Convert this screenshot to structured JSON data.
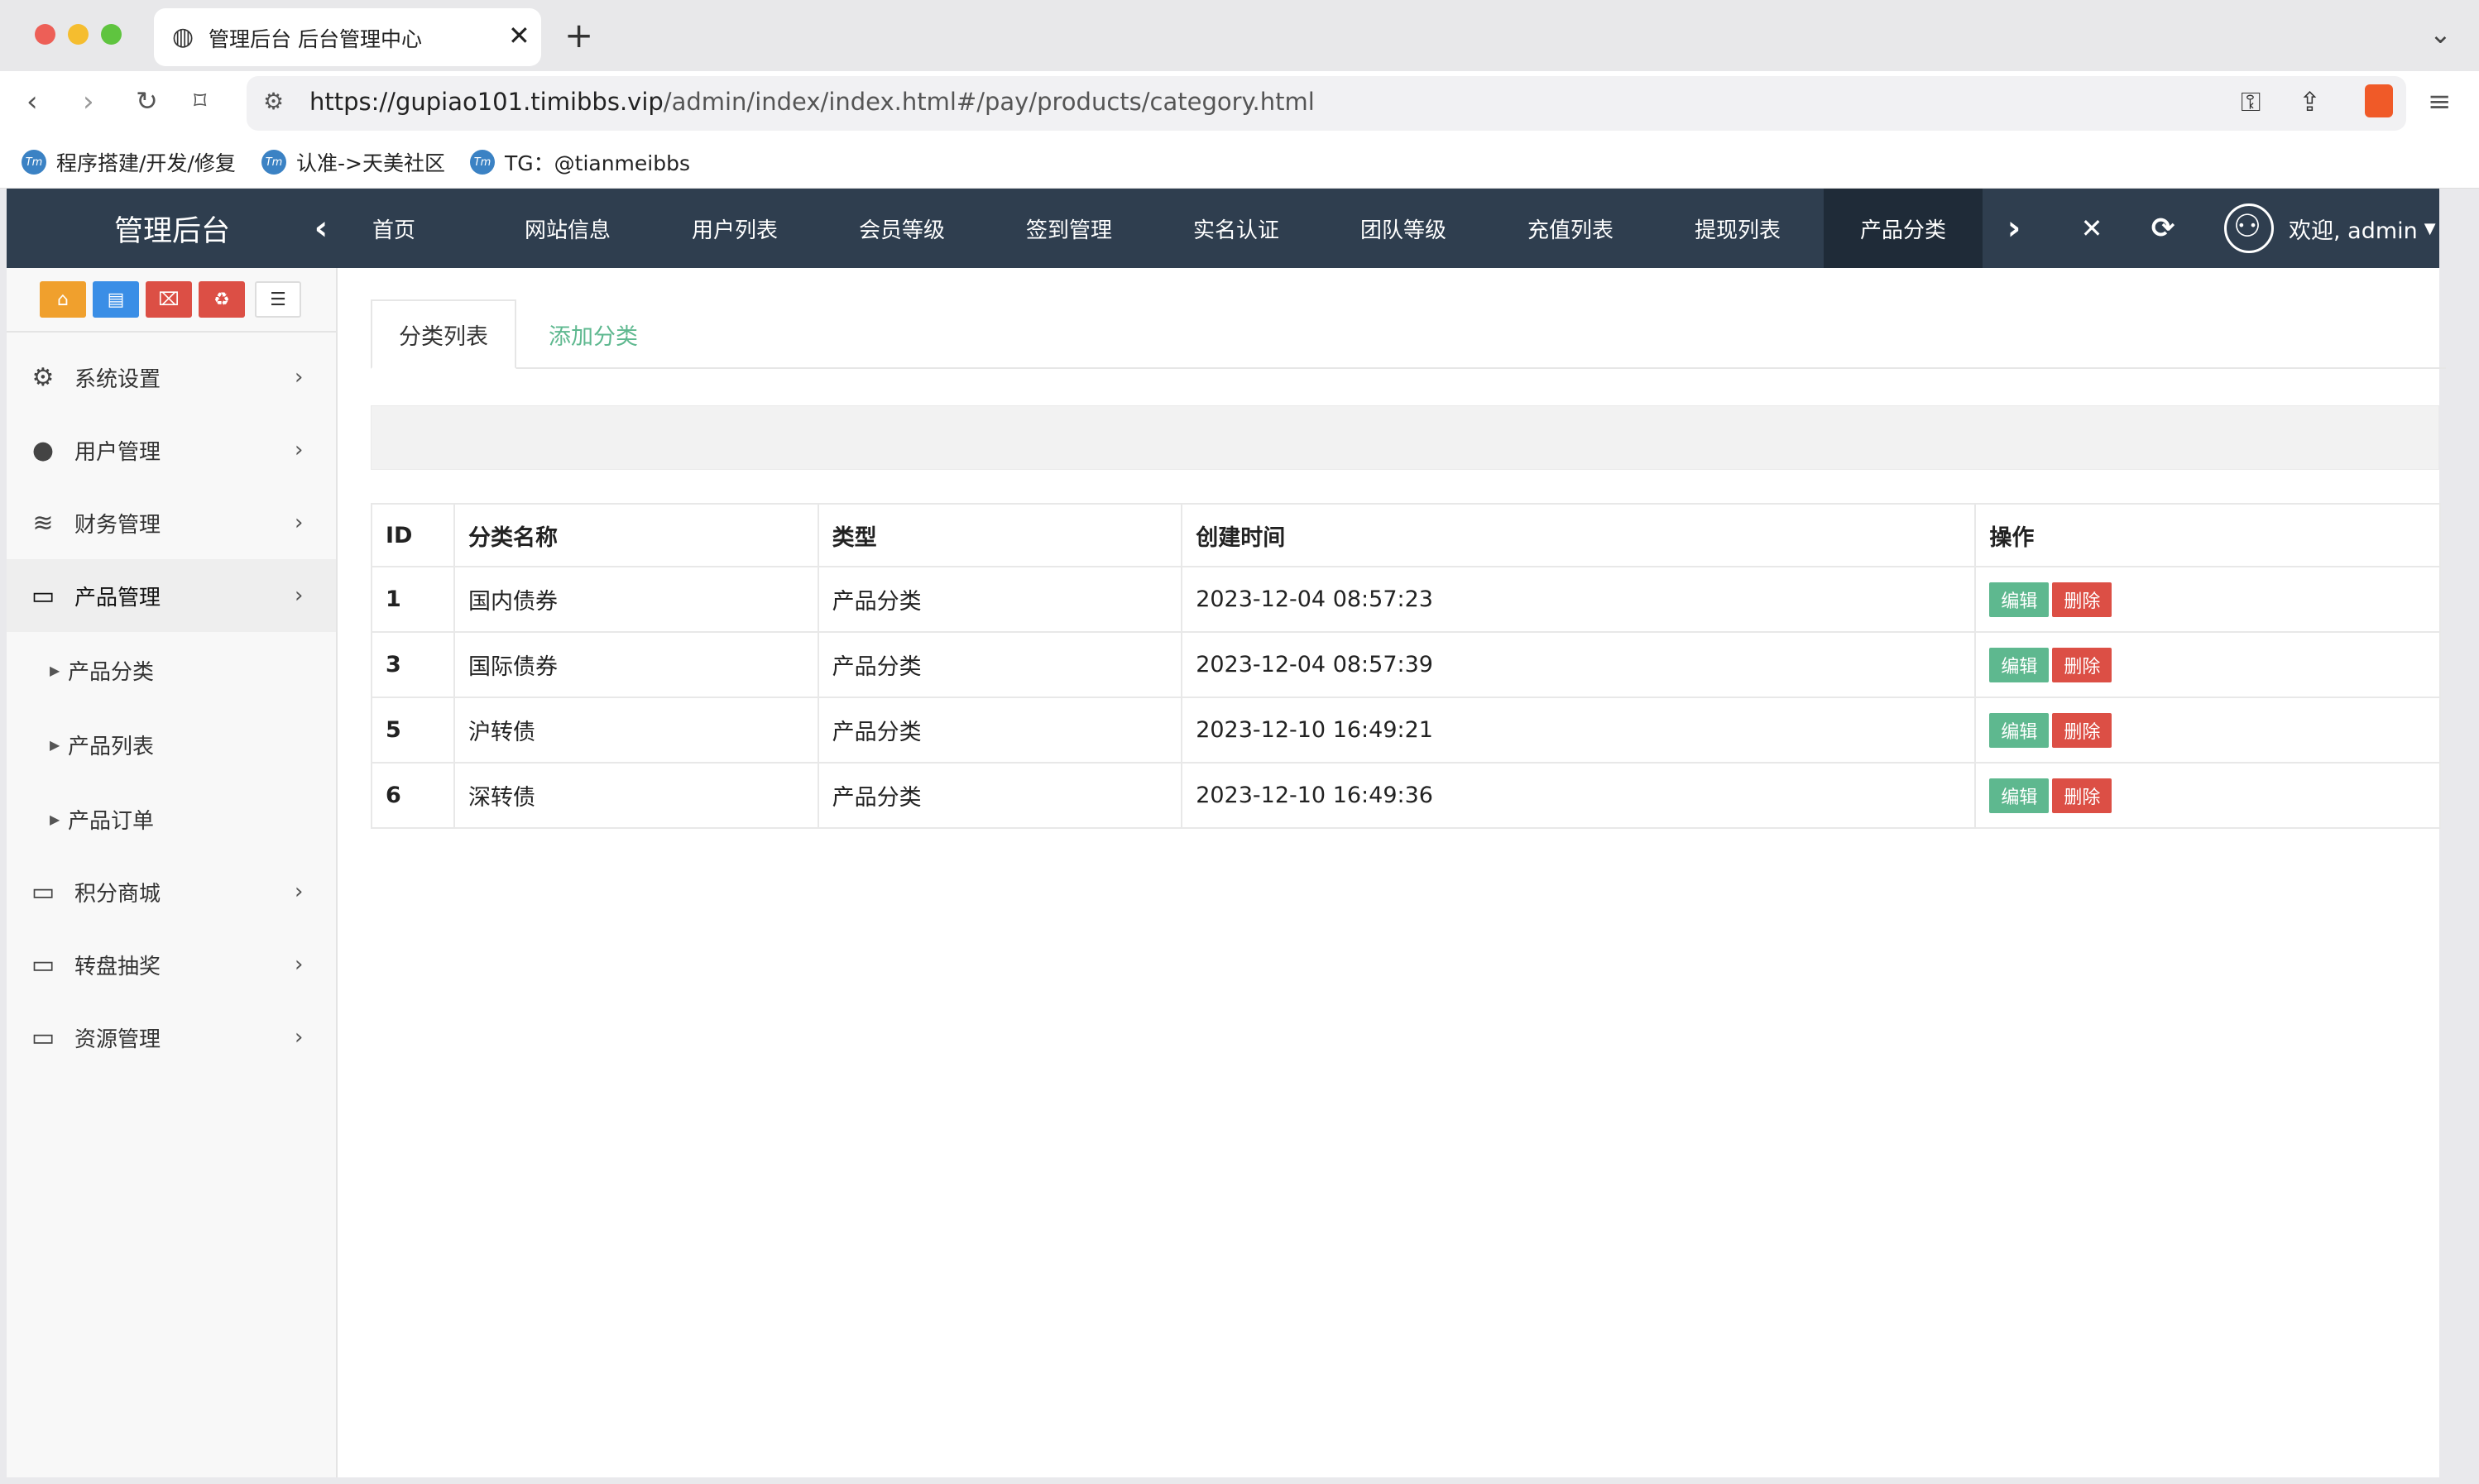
{
  "browser": {
    "tab_title": "管理后台 后台管理中心",
    "url_host": "https://gupiao101.timibbs.vip",
    "url_path": "/admin/index/index.html#/pay/products/category.html",
    "bookmarks": [
      "程序搭建/开发/修复",
      "认准->天美社区",
      "TG：@tianmeibbs"
    ],
    "bookmark_favicon": "Tm"
  },
  "app": {
    "brand": "管理后台",
    "nav_items": [
      "首页",
      "网站信息",
      "用户列表",
      "会员等级",
      "签到管理",
      "实名认证",
      "团队等级",
      "充值列表",
      "提现列表",
      "产品分类"
    ],
    "active_nav": "产品分类",
    "welcome": "欢迎, admin"
  },
  "sidebar": {
    "items": [
      {
        "label": "系统设置",
        "icon": "gears-icon"
      },
      {
        "label": "用户管理",
        "icon": "user-icon"
      },
      {
        "label": "财务管理",
        "icon": "database-icon"
      },
      {
        "label": "产品管理",
        "icon": "monitor-icon"
      },
      {
        "label": "积分商城",
        "icon": "monitor-icon"
      },
      {
        "label": "转盘抽奖",
        "icon": "monitor-icon"
      },
      {
        "label": "资源管理",
        "icon": "monitor-icon"
      }
    ],
    "sub_items": [
      "产品分类",
      "产品列表",
      "产品订单"
    ]
  },
  "content": {
    "tabs": [
      "分类列表",
      "添加分类"
    ],
    "table": {
      "headers": [
        "ID",
        "分类名称",
        "类型",
        "创建时间",
        "操作"
      ],
      "rows": [
        {
          "id": "1",
          "name": "国内债券",
          "type": "产品分类",
          "created": "2023-12-04 08:57:23"
        },
        {
          "id": "3",
          "name": "国际债券",
          "type": "产品分类",
          "created": "2023-12-04 08:57:39"
        },
        {
          "id": "5",
          "name": "沪转债",
          "type": "产品分类",
          "created": "2023-12-10 16:49:21"
        },
        {
          "id": "6",
          "name": "深转债",
          "type": "产品分类",
          "created": "2023-12-10 16:49:36"
        }
      ],
      "edit_label": "编辑",
      "delete_label": "删除"
    }
  },
  "colors": {
    "topnav": "#2f3e4f",
    "topnav_active": "#1f2b38",
    "edit": "#5eb88f",
    "delete": "#dc4f45",
    "link_green": "#5eb88f",
    "quick_orange": "#f0a02d",
    "quick_blue": "#3a8ee6",
    "quick_red": "#dc4f45"
  }
}
